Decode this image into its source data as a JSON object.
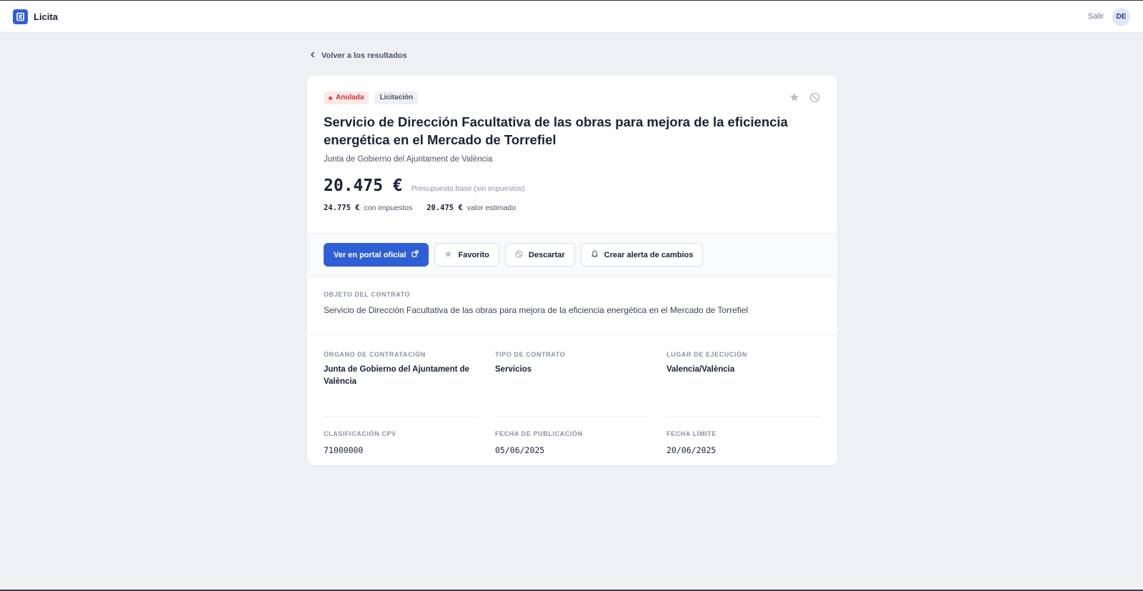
{
  "header": {
    "app_name": "Licita",
    "logout_label": "Salir",
    "avatar_initials": "DE"
  },
  "nav": {
    "back_label": "Volver a los resultados"
  },
  "tender": {
    "status_badge": "Anulada",
    "type_badge": "Licitación",
    "title": "Servicio de Dirección Facultativa de las obras para mejora de la eficiencia energética en el Mercado de Torrefiel",
    "organization": "Junta de Gobierno del Ajuntament de València",
    "price": "20.475 €",
    "price_label": "Presupuesto base (sin impuestos)",
    "price_with_tax": "24.775 €",
    "price_with_tax_label": "con impuestos",
    "estimated_value": "20.475 €",
    "estimated_value_label": "valor estimado"
  },
  "actions": {
    "portal_label": "Ver en portal oficial",
    "favorite_label": "Favorito",
    "discard_label": "Descartar",
    "alert_label": "Crear alerta de cambios"
  },
  "objeto": {
    "label": "OBJETO DEL CONTRATO",
    "text": "Servicio de Dirección Facultativa de las obras para mejora de la eficiencia energética en el Mercado de Torrefiel"
  },
  "details": [
    {
      "label": "ÓRGANO DE CONTRATACIÓN",
      "value": "Junta de Gobierno del Ajuntament de València"
    },
    {
      "label": "TIPO DE CONTRATO",
      "value": "Servicios"
    },
    {
      "label": "LUGAR DE EJECUCIÓN",
      "value": "Valencia/València"
    },
    {
      "label": "CLASIFICACIÓN CPV",
      "value": "71000000"
    },
    {
      "label": "FECHA DE PUBLICACIÓN",
      "value": "05/06/2025"
    },
    {
      "label": "FECHA LÍMITE",
      "value": "20/06/2025"
    }
  ],
  "colors": {
    "accent": "#2f5fd6",
    "status_red": "#c0392b",
    "background": "#eef0f4"
  },
  "icons": {
    "logo": "logo-icon",
    "back": "chevron-left-icon",
    "star": "star-icon",
    "ban": "ban-icon",
    "external": "external-link-icon",
    "bell": "bell-icon"
  }
}
